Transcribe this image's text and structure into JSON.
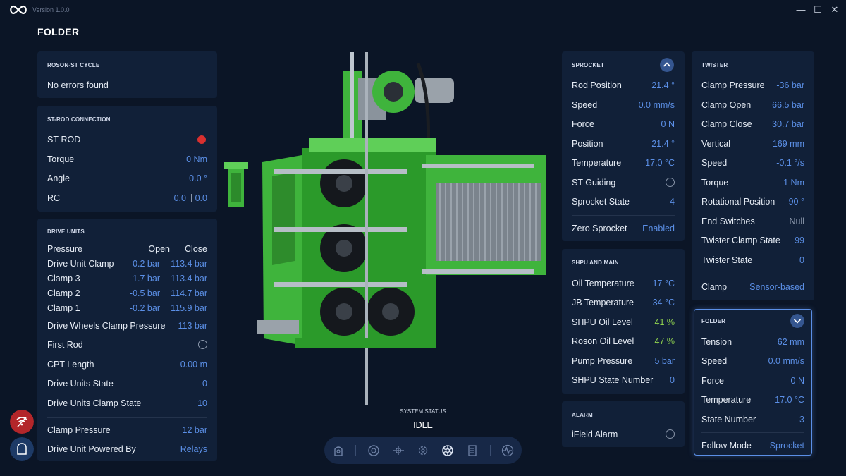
{
  "app": {
    "version": "Version 1.0.0",
    "page_title": "FOLDER"
  },
  "window_controls": {
    "minimize": "—",
    "maximize": "☐",
    "close": "✕"
  },
  "roson_cycle": {
    "title": "ROSON-ST CYCLE",
    "message": "No errors found"
  },
  "st_rod": {
    "title": "ST-ROD CONNECTION",
    "st_rod_label": "ST-ROD",
    "status_color": "#d9302f",
    "torque_label": "Torque",
    "torque_value": "0 Nm",
    "angle_label": "Angle",
    "angle_value": "0.0 °",
    "rc_label": "RC",
    "rc_value_1": "0.0",
    "rc_value_2": "0.0"
  },
  "drive_units": {
    "title": "DRIVE UNITS",
    "header": {
      "name": "Pressure",
      "open": "Open",
      "close": "Close"
    },
    "rows": [
      {
        "name": "Drive Unit Clamp",
        "open": "-0.2 bar",
        "close": "113.4 bar"
      },
      {
        "name": "Clamp 3",
        "open": "-1.7 bar",
        "close": "113.4 bar"
      },
      {
        "name": "Clamp 2",
        "open": "-0.5 bar",
        "close": "114.7 bar"
      },
      {
        "name": "Clamp 1",
        "open": "-0.2 bar",
        "close": "115.9 bar"
      }
    ],
    "wheels_label": "Drive Wheels Clamp Pressure",
    "wheels_value": "113 bar",
    "first_rod_label": "First Rod",
    "cpt_label": "CPT Length",
    "cpt_value": "0.00 m",
    "state_label": "Drive Units State",
    "state_value": "0",
    "clamp_state_label": "Drive Units Clamp State",
    "clamp_state_value": "10",
    "clamp_pressure_label": "Clamp Pressure",
    "clamp_pressure_value": "12 bar",
    "powered_label": "Drive Unit Powered By",
    "powered_value": "Relays"
  },
  "sprocket": {
    "title": "SPROCKET",
    "toggle_icon": "chevron-up-icon",
    "rows": [
      {
        "label": "Rod Position",
        "value": "21.4 °"
      },
      {
        "label": "Speed",
        "value": "0.0 mm/s"
      },
      {
        "label": "Force",
        "value": "0 N"
      },
      {
        "label": "Position",
        "value": "21.4 °"
      },
      {
        "label": "Temperature",
        "value": "17.0 °C"
      }
    ],
    "st_guiding_label": "ST Guiding",
    "state_label": "Sprocket State",
    "state_value": "4",
    "zero_label": "Zero Sprocket",
    "zero_value": "Enabled"
  },
  "shpu": {
    "title": "SHPU AND MAIN",
    "rows": [
      {
        "label": "Oil Temperature",
        "value": "17 °C",
        "color": "#5b8fe6"
      },
      {
        "label": "JB Temperature",
        "value": "34 °C",
        "color": "#5b8fe6"
      },
      {
        "label": "SHPU Oil Level",
        "value": "41 %",
        "color": "#8fd14f"
      },
      {
        "label": "Roson Oil Level",
        "value": "47 %",
        "color": "#8fd14f"
      },
      {
        "label": "Pump Pressure",
        "value": "5 bar",
        "color": "#5b8fe6"
      },
      {
        "label": "SHPU State Number",
        "value": "0",
        "color": "#5b8fe6"
      }
    ]
  },
  "alarm": {
    "title": "ALARM",
    "ifield_label": "iField Alarm"
  },
  "twister": {
    "title": "TWISTER",
    "rows": [
      {
        "label": "Clamp Pressure",
        "value": "-36 bar"
      },
      {
        "label": "Clamp Open",
        "value": "66.5 bar"
      },
      {
        "label": "Clamp Close",
        "value": "30.7 bar"
      },
      {
        "label": "Vertical",
        "value": "169 mm"
      },
      {
        "label": "Speed",
        "value": "-0.1 °/s"
      },
      {
        "label": "Torque",
        "value": "-1 Nm"
      },
      {
        "label": "Rotational Position",
        "value": "90 °"
      },
      {
        "label": "End Switches",
        "value": "Null"
      },
      {
        "label": "Twister Clamp State",
        "value": "99"
      },
      {
        "label": "Twister State",
        "value": "0"
      }
    ],
    "clamp_label": "Clamp",
    "clamp_value": "Sensor-based"
  },
  "folder": {
    "title": "FOLDER",
    "toggle_icon": "chevron-down-icon",
    "rows": [
      {
        "label": "Tension",
        "value": "62 mm"
      },
      {
        "label": "Speed",
        "value": "0.0 mm/s"
      },
      {
        "label": "Force",
        "value": "0 N"
      },
      {
        "label": "Temperature",
        "value": "17.0 °C"
      },
      {
        "label": "State Number",
        "value": "3"
      }
    ],
    "follow_label": "Follow Mode",
    "follow_value": "Sprocket"
  },
  "system": {
    "label": "SYSTEM STATUS",
    "value": "IDLE"
  },
  "navbar": {
    "items": [
      "home-icon",
      "drive-icon",
      "rod-icon",
      "gear-icon",
      "sprocket-icon",
      "list-icon",
      "waveform-icon"
    ],
    "active": "sprocket-icon"
  },
  "colors": {
    "accent": "#5b8fe6",
    "ok": "#8fd14f",
    "alarm": "#d9302f",
    "machine": "#3fb43c"
  }
}
